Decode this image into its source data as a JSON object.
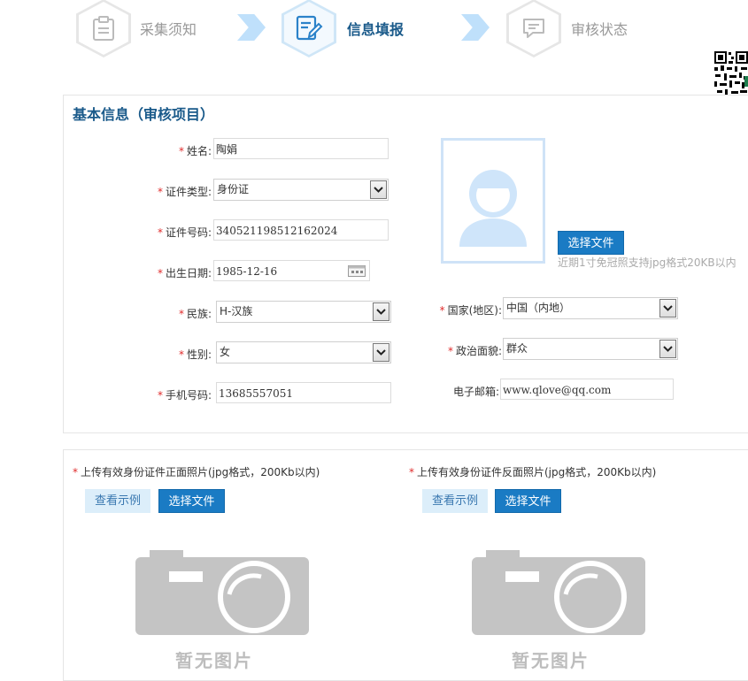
{
  "steps": [
    {
      "label": "采集须知",
      "icon": "clipboard-icon",
      "active": false
    },
    {
      "label": "信息填报",
      "icon": "form-edit-icon",
      "active": true
    },
    {
      "label": "审核状态",
      "icon": "chat-icon",
      "active": false
    }
  ],
  "section_title": "基本信息（审核项目）",
  "fields": {
    "name": {
      "label": "姓名:",
      "value": "陶娟"
    },
    "id_type": {
      "label": "证件类型:",
      "value": "身份证"
    },
    "id_number": {
      "label": "证件号码:",
      "value": "340521198512162024"
    },
    "birth_date": {
      "label": "出生日期:",
      "value": "1985-12-16"
    },
    "ethnicity": {
      "label": "民族:",
      "value": "H-汉族"
    },
    "gender": {
      "label": "性别:",
      "value": "女"
    },
    "phone": {
      "label": "手机号码:",
      "value": "13685557051"
    },
    "country": {
      "label": "国家(地区):",
      "value": "中国（内地）"
    },
    "political": {
      "label": "政治面貌:",
      "value": "群众"
    },
    "email": {
      "label": "电子邮箱:",
      "value": "www.qlove@qq.com"
    }
  },
  "photo": {
    "choose_button": "选择文件",
    "hint": "近期1寸免冠照支持jpg格式20KB以内"
  },
  "uploads": {
    "front": {
      "label": "上传有效身份证件正面照片(jpg格式，200Kb以内)",
      "example_button": "查看示例",
      "choose_button": "选择文件",
      "placeholder": "暂无图片"
    },
    "back": {
      "label": "上传有效身份证件反面照片(jpg格式，200Kb以内)",
      "example_button": "查看示例",
      "choose_button": "选择文件",
      "placeholder": "暂无图片"
    }
  },
  "required_mark": "*",
  "colors": {
    "accent": "#1a7bc4",
    "title": "#1a5a8a",
    "required": "#e02b2b"
  }
}
